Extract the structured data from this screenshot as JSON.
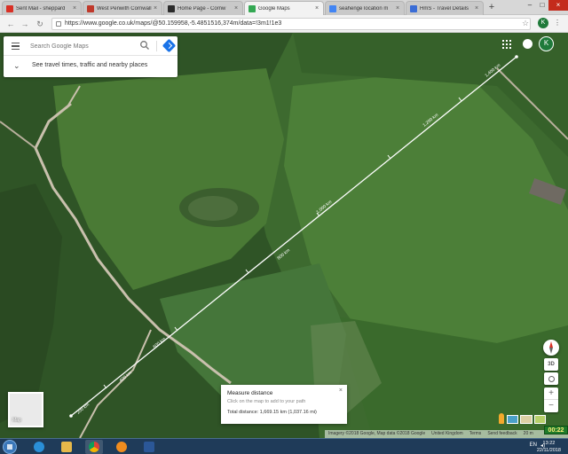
{
  "browser": {
    "tabs": [
      {
        "label": "Sent Mail - sheppard",
        "favicon": "gmail-icon",
        "color": "#d93025",
        "active": false
      },
      {
        "label": "West Penwith Cornwall",
        "favicon": "shield-icon",
        "color": "#c0392b",
        "active": false
      },
      {
        "label": "Home Page - Cornw",
        "favicon": "bird-icon",
        "color": "#2b2b2b",
        "active": false
      },
      {
        "label": "Google Maps",
        "favicon": "maps-pin-icon",
        "color": "#34a853",
        "active": true
      },
      {
        "label": "seahenge location m",
        "favicon": "google-icon",
        "color": "#4285f4",
        "active": false
      },
      {
        "label": "HmS - Travel Details",
        "favicon": "page-icon",
        "color": "#3b6dd6",
        "active": false
      }
    ],
    "new_tab_label": "+",
    "url": "https://www.google.co.uk/maps/@50.159958,-5.4851516,374m/data=!3m1!1e3",
    "profile_initial": "K"
  },
  "map": {
    "search_placeholder": "Search Google Maps",
    "travel_prompt": "See travel times, traffic and nearby places",
    "profile_initial": "K",
    "path_labels": [
      "1,400 km",
      "1,200 km",
      "1,000 km",
      "800 km",
      "600 km",
      "400 km",
      "200 km"
    ],
    "measure": {
      "title": "Measure distance",
      "hint": "Click on the map to add to your path",
      "total": "Total distance: 1,669.15 km (1,037.16 mi)"
    },
    "minimap_label": "Map",
    "button_3d": "3D",
    "zoom_in": "+",
    "zoom_out": "−",
    "attribution": [
      "Imagery ©2018 Google, Map data ©2018 Google",
      "United Kingdom",
      "Terms",
      "Send feedback",
      "20 m"
    ]
  },
  "taskbar": {
    "time": "13:22",
    "date": "22/11/2018",
    "tray_lang": "EN",
    "timer": "00:22"
  },
  "colors": {
    "field_dark": "#2c4a24",
    "field_mid": "#3e6a30",
    "field_light": "#4f7c3a",
    "road": "#c9c0ad",
    "measure_line": "#ffffff"
  }
}
